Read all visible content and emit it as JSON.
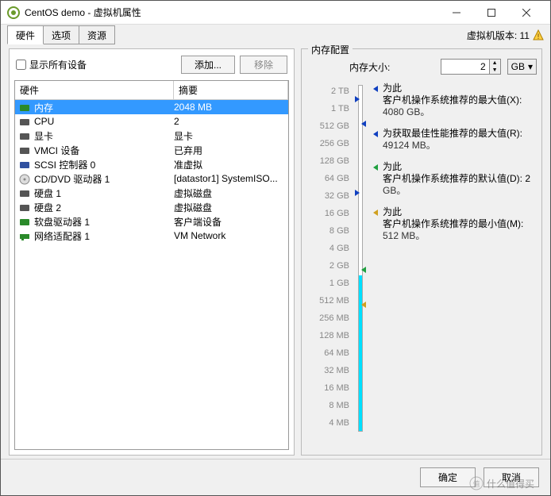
{
  "title": "CentOS demo - 虚拟机属性",
  "tabs": [
    "硬件",
    "选项",
    "资源"
  ],
  "version_label": "虚拟机版本: 11",
  "left": {
    "show_all": "显示所有设备",
    "add_btn": "添加...",
    "remove_btn": "移除",
    "col_hw": "硬件",
    "col_sum": "摘要"
  },
  "hw": [
    {
      "name": "内存",
      "summary": "2048 MB",
      "icon": "mem"
    },
    {
      "name": "CPU",
      "summary": "2",
      "icon": "cpu"
    },
    {
      "name": "显卡",
      "summary": "显卡",
      "icon": "video"
    },
    {
      "name": "VMCI 设备",
      "summary": "已弃用",
      "icon": "vmci"
    },
    {
      "name": "SCSI 控制器 0",
      "summary": "准虚拟",
      "icon": "scsi"
    },
    {
      "name": "CD/DVD 驱动器 1",
      "summary": "[datastor1] SystemISO...",
      "icon": "cd"
    },
    {
      "name": "硬盘 1",
      "summary": "虚拟磁盘",
      "icon": "disk"
    },
    {
      "name": "硬盘 2",
      "summary": "虚拟磁盘",
      "icon": "disk"
    },
    {
      "name": "软盘驱动器 1",
      "summary": "客户端设备",
      "icon": "floppy"
    },
    {
      "name": "网络适配器 1",
      "summary": "VM Network",
      "icon": "nic"
    }
  ],
  "mem": {
    "legend": "内存配置",
    "size_label": "内存大小:",
    "size_value": "2",
    "unit": "GB",
    "scale": [
      "2 TB",
      "1 TB",
      "512 GB",
      "256 GB",
      "128 GB",
      "64 GB",
      "32 GB",
      "16 GB",
      "8 GB",
      "4 GB",
      "2 GB",
      "1 GB",
      "512 MB",
      "256 MB",
      "128 MB",
      "64 MB",
      "32 MB",
      "16 MB",
      "8 MB",
      "4 MB"
    ],
    "descs": [
      {
        "color": "blue",
        "t1": "为此",
        "t2": "客户机操作系统推荐的最大值(X):",
        "sub": "4080 GB。"
      },
      {
        "color": "blue",
        "t1": "为获取最佳性能推荐的最大值(R):",
        "t2": "",
        "sub": "49124 MB。"
      },
      {
        "color": "green",
        "t1": "为此",
        "t2": "客户机操作系统推荐的默认值(D): 2",
        "sub": "GB。"
      },
      {
        "color": "orange",
        "t1": "为此",
        "t2": "客户机操作系统推荐的最小值(M):",
        "sub": "512 MB。"
      }
    ]
  },
  "footer": {
    "ok": "确定",
    "cancel": "取消"
  },
  "watermark": "什么值得买"
}
